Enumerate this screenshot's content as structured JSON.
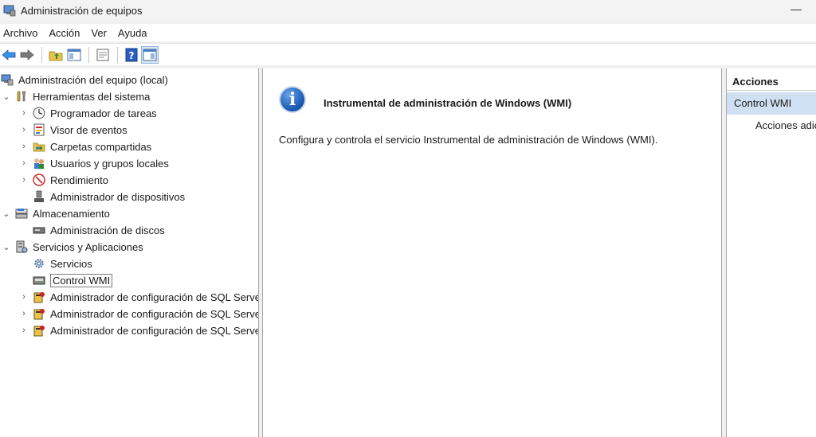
{
  "window": {
    "title": "Administración de equipos",
    "minimize_glyph": "—"
  },
  "menu": [
    "Archivo",
    "Acción",
    "Ver",
    "Ayuda"
  ],
  "toolbar": {
    "icons": [
      "back-arrow-icon",
      "forward-arrow-icon",
      "up-folder-icon",
      "show-hide-tree-icon",
      "properties-icon",
      "help-icon",
      "show-hide-action-pane-icon"
    ]
  },
  "tree": [
    {
      "label": "Administración del equipo (local)",
      "icon": "computer-management-icon",
      "chevron": ""
    },
    {
      "label": "Herramientas del sistema",
      "icon": "system-tools-icon",
      "chevron": "⌄"
    },
    {
      "label": "Programador de tareas",
      "icon": "task-scheduler-icon",
      "chevron": "›"
    },
    {
      "label": "Visor de eventos",
      "icon": "event-viewer-icon",
      "chevron": "›"
    },
    {
      "label": "Carpetas compartidas",
      "icon": "shared-folders-icon",
      "chevron": "›"
    },
    {
      "label": "Usuarios y grupos locales",
      "icon": "users-groups-icon",
      "chevron": "›"
    },
    {
      "label": "Rendimiento",
      "icon": "performance-icon",
      "chevron": "›"
    },
    {
      "label": "Administrador de dispositivos",
      "icon": "device-manager-icon",
      "chevron": ""
    },
    {
      "label": "Almacenamiento",
      "icon": "storage-icon",
      "chevron": "⌄"
    },
    {
      "label": "Administración de discos",
      "icon": "disk-management-icon",
      "chevron": ""
    },
    {
      "label": "Servicios y Aplicaciones",
      "icon": "services-apps-icon",
      "chevron": "⌄"
    },
    {
      "label": "Servicios",
      "icon": "services-gear-icon",
      "chevron": ""
    },
    {
      "label": "Control WMI",
      "icon": "wmi-control-icon",
      "chevron": ""
    },
    {
      "label": "Administrador de configuración de SQL Server",
      "icon": "sql-config-icon",
      "chevron": "›"
    },
    {
      "label": "Administrador de configuración de SQL Server",
      "icon": "sql-config-icon",
      "chevron": "›"
    },
    {
      "label": "Administrador de configuración de SQL Server",
      "icon": "sql-config-icon",
      "chevron": "›"
    }
  ],
  "center": {
    "title": "Instrumental de administración de Windows (WMI)",
    "description": "Configura y controla el servicio Instrumental de administración de Windows (WMI)."
  },
  "actions": {
    "header": "Acciones",
    "group": "Control WMI",
    "item": "Acciones adicionales"
  }
}
